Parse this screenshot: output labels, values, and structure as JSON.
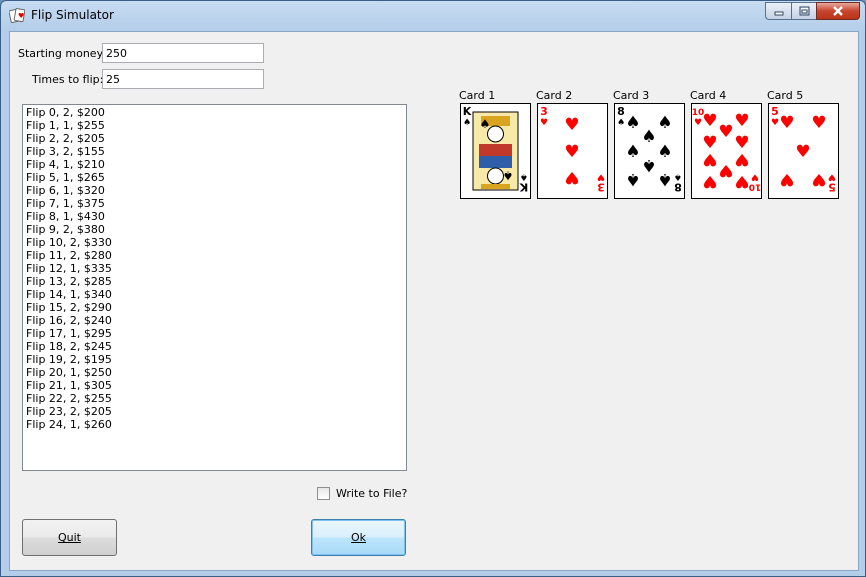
{
  "window": {
    "title": "Flip Simulator",
    "icons": {
      "app": "playing-cards-icon",
      "minimize": "minimize-icon",
      "maximize": "maximize-icon",
      "close": "close-icon"
    }
  },
  "form": {
    "starting_money_label": "Starting money:",
    "starting_money_value": "250",
    "times_to_flip_label": "Times to flip:",
    "times_to_flip_value": "25"
  },
  "results": [
    "Flip 0, 2, $200",
    "Flip 1, 1, $255",
    "Flip 2, 2, $205",
    "Flip 3, 2, $155",
    "Flip 4, 1, $210",
    "Flip 5, 1, $265",
    "Flip 6, 1, $320",
    "Flip 7, 1, $375",
    "Flip 8, 1, $430",
    "Flip 9, 2, $380",
    "Flip 10, 2, $330",
    "Flip 11, 2, $280",
    "Flip 12, 1, $335",
    "Flip 13, 2, $285",
    "Flip 14, 1, $340",
    "Flip 15, 2, $290",
    "Flip 16, 2, $240",
    "Flip 17, 1, $295",
    "Flip 18, 2, $245",
    "Flip 19, 2, $195",
    "Flip 20, 1, $250",
    "Flip 21, 1, $305",
    "Flip 22, 2, $255",
    "Flip 23, 2, $205",
    "Flip 24, 1, $260"
  ],
  "write_to_file": {
    "label": "Write to File?",
    "checked": false
  },
  "buttons": {
    "quit": "Quit",
    "ok": "Ok"
  },
  "cards": [
    {
      "label": "Card 1",
      "rank": "K",
      "suit": "spades"
    },
    {
      "label": "Card 2",
      "rank": "3",
      "suit": "hearts"
    },
    {
      "label": "Card 3",
      "rank": "8",
      "suit": "spades"
    },
    {
      "label": "Card 4",
      "rank": "10",
      "suit": "hearts"
    },
    {
      "label": "Card 5",
      "rank": "5",
      "suit": "hearts"
    }
  ],
  "colors": {
    "red_suit": "#ff0000",
    "black_suit": "#000000"
  }
}
